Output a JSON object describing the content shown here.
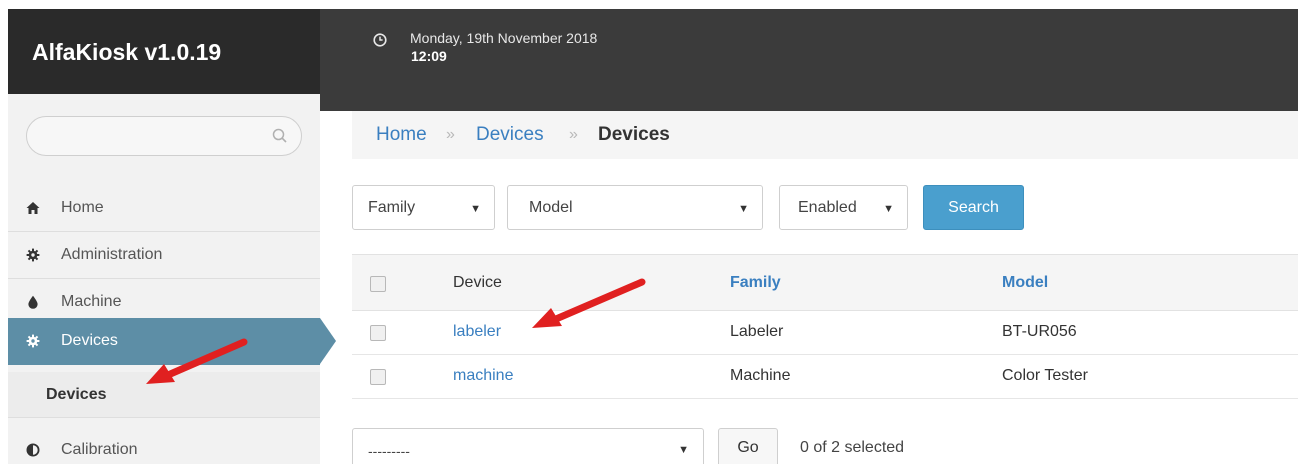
{
  "header": {
    "app_title": "AlfaKiosk v1.0.19",
    "date": "Monday, 19th November 2018",
    "time": "12:09",
    "clock_icon": "clock-icon"
  },
  "sidebar": {
    "search": {
      "placeholder": "",
      "icon": "search-icon"
    },
    "items": [
      {
        "label": "Home",
        "icon": "home-icon"
      },
      {
        "label": "Administration",
        "icon": "gear-icon"
      },
      {
        "label": "Machine",
        "icon": "drop-icon"
      },
      {
        "label": "Devices",
        "icon": "gear-icon",
        "active": true
      },
      {
        "label": "Devices",
        "sub": true
      },
      {
        "label": "Calibration",
        "icon": "half-circle-icon"
      }
    ]
  },
  "breadcrumb": {
    "items": [
      "Home",
      "Devices",
      "Devices"
    ],
    "separator": "»"
  },
  "filters": {
    "family": "Family",
    "model": "Model",
    "enabled": "Enabled",
    "search_label": "Search"
  },
  "table": {
    "columns": [
      "Device",
      "Family",
      "Model"
    ],
    "rows": [
      {
        "device": "labeler",
        "family": "Labeler",
        "model": "BT-UR056"
      },
      {
        "device": "machine",
        "family": "Machine",
        "model": "Color Tester"
      }
    ]
  },
  "actions": {
    "select_value": "---------",
    "go_label": "Go",
    "selected_text": "0 of 2 selected"
  },
  "colors": {
    "topbar": "#3b3b3b",
    "brand": "#2a2a2a",
    "active_nav": "#5d8ea6",
    "link": "#3a7fc0",
    "search_button": "#4a9fce",
    "annotation_arrow": "#e02020"
  }
}
